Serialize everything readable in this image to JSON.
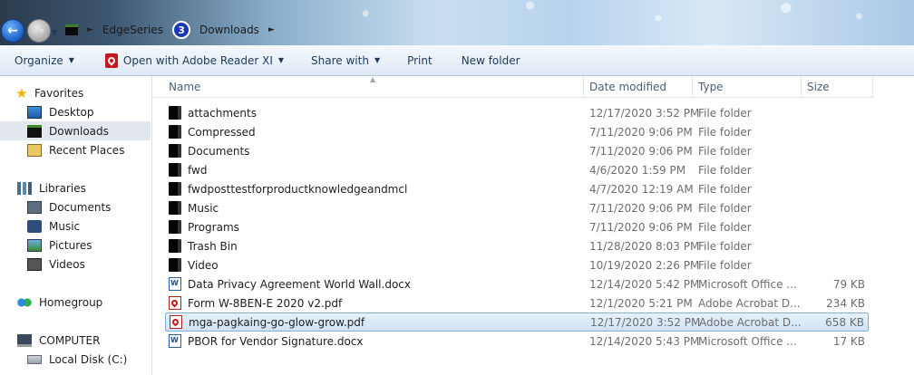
{
  "address": {
    "crumbs": [
      "EdgeSeries",
      "Downloads"
    ],
    "badge_number": "3"
  },
  "toolbar": {
    "organize_label": "Organize",
    "open_with_label": "Open with Adobe Reader XI",
    "share_label": "Share with",
    "print_label": "Print",
    "new_folder_label": "New folder"
  },
  "nav": {
    "favorites": "Favorites",
    "desktop": "Desktop",
    "downloads": "Downloads",
    "recent": "Recent Places",
    "libraries": "Libraries",
    "documents": "Documents",
    "music": "Music",
    "pictures": "Pictures",
    "videos": "Videos",
    "homegroup": "Homegroup",
    "computer": "COMPUTER",
    "local_disk": "Local Disk (C:)"
  },
  "columns": {
    "name": "Name",
    "date": "Date modified",
    "type": "Type",
    "size": "Size"
  },
  "files": [
    {
      "name": "attachments",
      "date": "12/17/2020 3:52 PM",
      "type": "File folder",
      "size": "",
      "icon": "folder-icon"
    },
    {
      "name": "Compressed",
      "date": "7/11/2020 9:06 PM",
      "type": "File folder",
      "size": "",
      "icon": "folder-icon"
    },
    {
      "name": "Documents",
      "date": "7/11/2020 9:06 PM",
      "type": "File folder",
      "size": "",
      "icon": "folder-icon"
    },
    {
      "name": "fwd",
      "date": "4/6/2020 1:59 PM",
      "type": "File folder",
      "size": "",
      "icon": "folder-icon"
    },
    {
      "name": "fwdposttestforproductknowledgeandmcl",
      "date": "4/7/2020 12:19 AM",
      "type": "File folder",
      "size": "",
      "icon": "folder-icon"
    },
    {
      "name": "Music",
      "date": "7/11/2020 9:06 PM",
      "type": "File folder",
      "size": "",
      "icon": "folder-icon"
    },
    {
      "name": "Programs",
      "date": "7/11/2020 9:06 PM",
      "type": "File folder",
      "size": "",
      "icon": "folder-icon"
    },
    {
      "name": "Trash Bin",
      "date": "11/28/2020 8:03 PM",
      "type": "File folder",
      "size": "",
      "icon": "folder-icon"
    },
    {
      "name": "Video",
      "date": "10/19/2020 2:26 PM",
      "type": "File folder",
      "size": "",
      "icon": "folder-icon"
    },
    {
      "name": "Data Privacy Agreement World Wall.docx",
      "date": "12/14/2020 5:42 PM",
      "type": "Microsoft Office ...",
      "size": "79 KB",
      "icon": "word-doc-icon"
    },
    {
      "name": "Form W-8BEN-E 2020 v2.pdf",
      "date": "12/1/2020 5:21 PM",
      "type": "Adobe Acrobat D...",
      "size": "234 KB",
      "icon": "pdf-doc-icon"
    },
    {
      "name": "mga-pagkaing-go-glow-grow.pdf",
      "date": "12/17/2020 3:52 PM",
      "type": "Adobe Acrobat D...",
      "size": "658 KB",
      "icon": "pdf-doc-icon",
      "selected": true
    },
    {
      "name": "PBOR for Vendor Signature.docx",
      "date": "12/14/2020 5:43 PM",
      "type": "Microsoft Office ...",
      "size": "17 KB",
      "icon": "word-doc-icon"
    }
  ]
}
